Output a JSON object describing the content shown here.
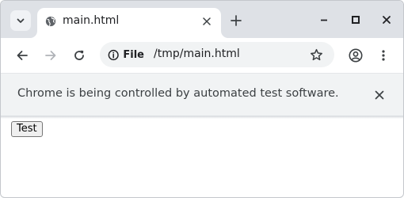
{
  "browser": {
    "tab": {
      "title": "main.html"
    },
    "address_bar": {
      "chip_label": "File",
      "url": "/tmp/main.html"
    },
    "infobar": {
      "message": "Chrome is being controlled by automated test software."
    }
  },
  "page": {
    "button_label": "Test"
  },
  "colors": {
    "tabstrip": "#dee1e6",
    "infobar": "#f1f3f4",
    "omnibox": "#f1f3f4",
    "icon": "#3c4043",
    "icon_disabled": "#b0b3b8"
  },
  "icons": [
    "chevron-down-icon",
    "globe-icon",
    "close-icon",
    "plus-icon",
    "minimize-icon",
    "maximize-icon",
    "back-arrow-icon",
    "forward-arrow-icon",
    "reload-icon",
    "info-icon",
    "star-icon",
    "profile-icon",
    "kebab-menu-icon"
  ]
}
